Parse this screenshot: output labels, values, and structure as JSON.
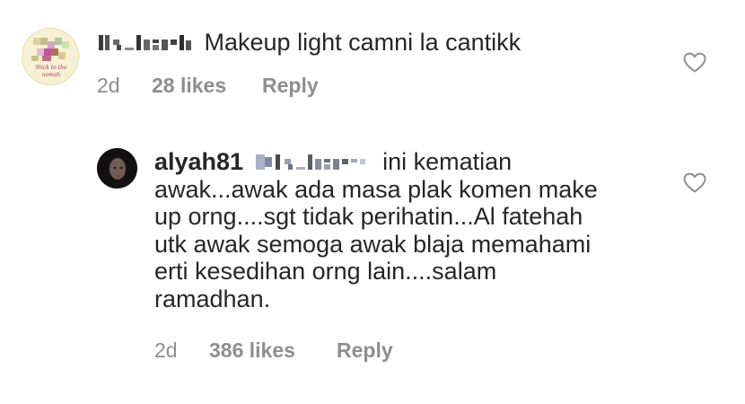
{
  "comments": [
    {
      "username_pixelated": true,
      "text": "Makeup light camni la cantikk",
      "avatar_caption": "Stick to the nomah",
      "time": "2d",
      "likes": "28 likes",
      "reply": "Reply"
    },
    {
      "username": "alyah81",
      "mention_pixelated": true,
      "lines": [
        "ini kematian",
        "awak...awak ada masa plak komen make",
        "up orng....sgt tidak perihatin...Al fatehah",
        "utk awak semoga awak blaja memahami",
        "erti kesedihan orng lain....salam",
        "ramadhan."
      ],
      "time": "2d",
      "likes": "386 likes",
      "reply": "Reply"
    }
  ],
  "icons": {
    "like": "heart-outline-icon"
  },
  "colors": {
    "text": "#262626",
    "meta": "#8e8e8e",
    "heart": "#8e8e8e"
  }
}
